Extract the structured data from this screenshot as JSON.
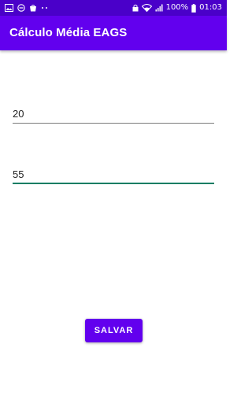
{
  "status_bar": {
    "left_icons": [
      "image-icon",
      "minus-circle-icon",
      "bag-icon",
      "more-dots-icon"
    ],
    "right_icons": [
      "lock-icon",
      "wifi-icon",
      "signal-icon",
      "battery-icon"
    ],
    "battery": "100%",
    "time": "01:03"
  },
  "app_bar": {
    "title": "Cálculo Média EAGS"
  },
  "fields": [
    {
      "value": "20"
    },
    {
      "value": "55"
    }
  ],
  "save_button": {
    "label": "SALVAR"
  },
  "colors": {
    "primary": "#6200ee",
    "status_bar": "#4a00c9",
    "focused_underline": "#0a7d63"
  }
}
